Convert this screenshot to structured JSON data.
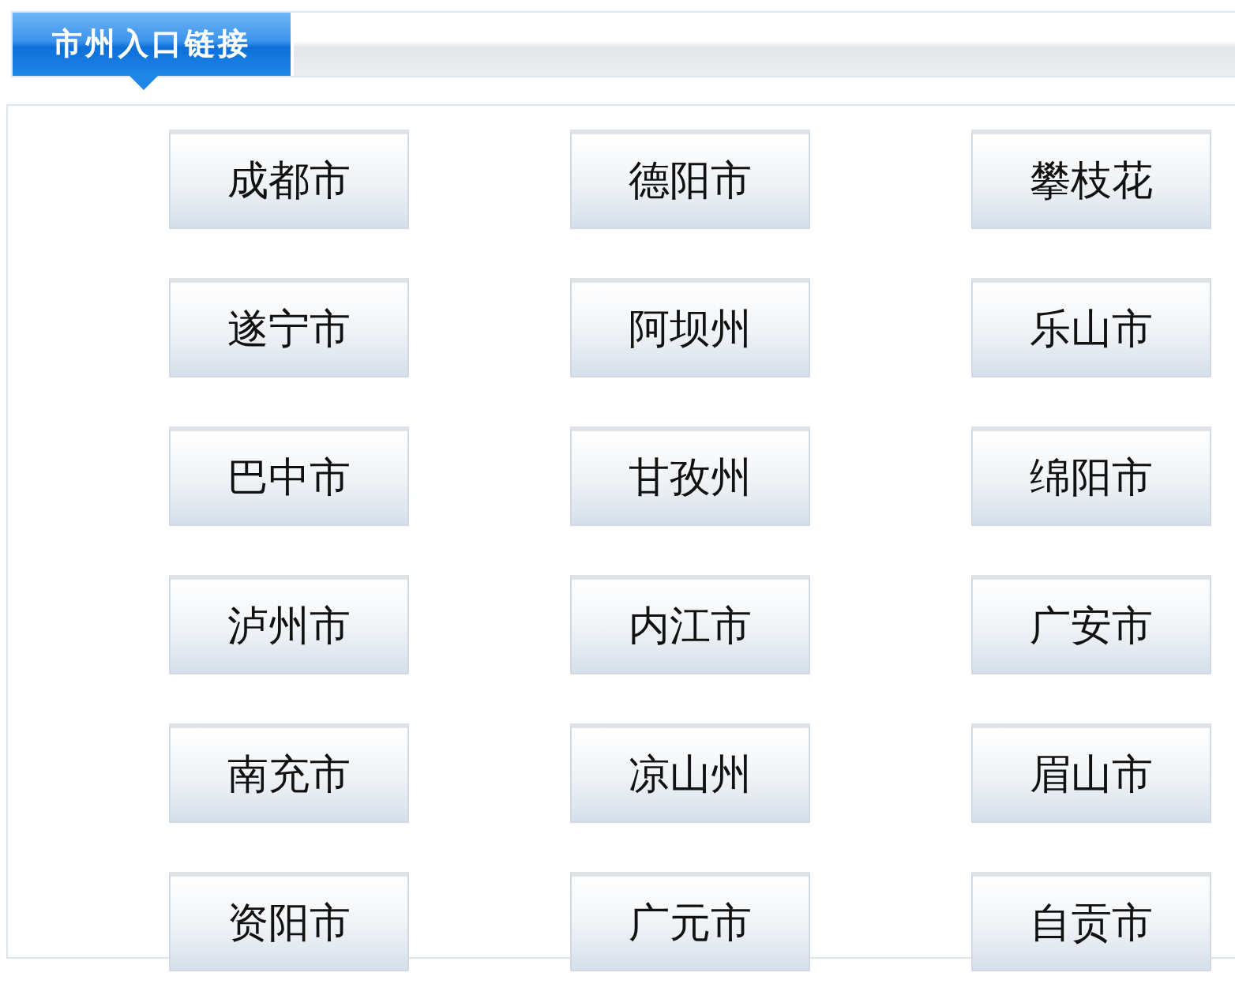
{
  "header": {
    "title": "市州入口链接"
  },
  "links": [
    {
      "label": "成都市"
    },
    {
      "label": "德阳市"
    },
    {
      "label": "攀枝花"
    },
    {
      "label": "遂宁市"
    },
    {
      "label": "阿坝州"
    },
    {
      "label": "乐山市"
    },
    {
      "label": "巴中市"
    },
    {
      "label": "甘孜州"
    },
    {
      "label": "绵阳市"
    },
    {
      "label": "泸州市"
    },
    {
      "label": "内江市"
    },
    {
      "label": "广安市"
    },
    {
      "label": "南充市"
    },
    {
      "label": "凉山州"
    },
    {
      "label": "眉山市"
    },
    {
      "label": "资阳市"
    },
    {
      "label": "广元市"
    },
    {
      "label": "自贡市"
    }
  ]
}
